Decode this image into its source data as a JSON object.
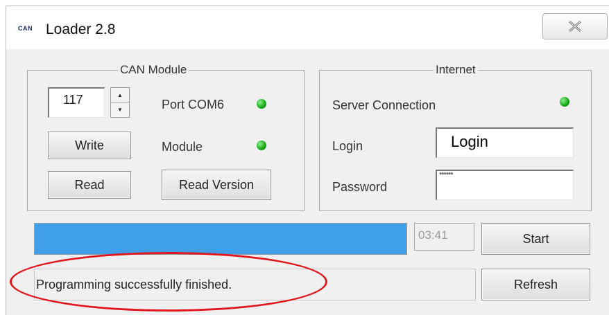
{
  "window": {
    "app_icon": "CAN",
    "title": "Loader 2.8",
    "close_icon": "close-x-icon"
  },
  "can_module": {
    "legend": "CAN Module",
    "address_value": "117",
    "port_label": "Port COM6",
    "port_status_color": "#14a614",
    "module_label": "Module",
    "module_status_color": "#14a614",
    "write_label": "Write",
    "read_label": "Read",
    "read_version_label": "Read Version"
  },
  "internet": {
    "legend": "Internet",
    "server_connection_label": "Server Connection",
    "server_status_color": "#14a614",
    "login_label": "Login",
    "login_value": "Login",
    "password_label": "Password",
    "password_value": "******"
  },
  "progress": {
    "fraction": 1.0,
    "time": "03:41",
    "start_label": "Start"
  },
  "status": {
    "message": "Programming successfully finished.",
    "refresh_label": "Refresh"
  }
}
